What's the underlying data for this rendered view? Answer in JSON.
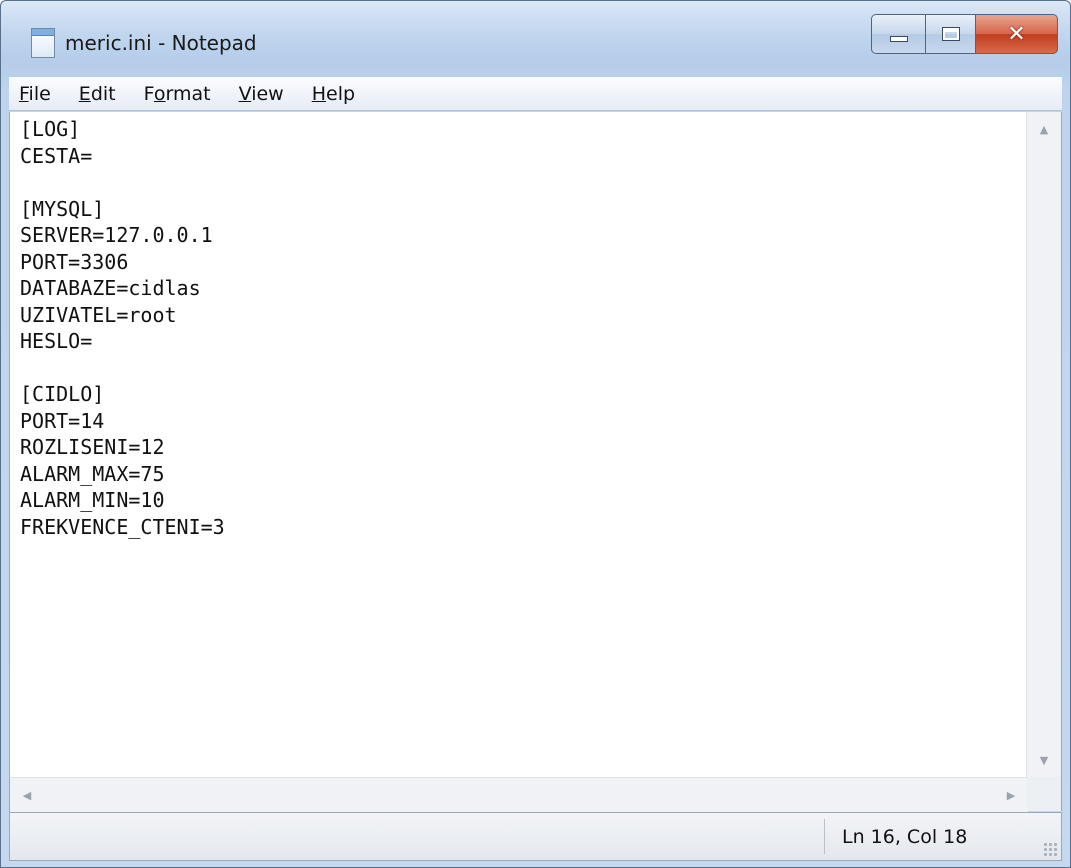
{
  "window": {
    "title": "meric.ini - Notepad"
  },
  "menu": [
    {
      "mnemonic": "F",
      "rest": "ile"
    },
    {
      "mnemonic": "E",
      "rest": "dit"
    },
    {
      "pre": "F",
      "mnemonic": "o",
      "rest": "rmat"
    },
    {
      "mnemonic": "V",
      "rest": "iew"
    },
    {
      "mnemonic": "H",
      "rest": "elp"
    }
  ],
  "editor": {
    "text": "[LOG]\nCESTA=\n\n[MYSQL]\nSERVER=127.0.0.1\nPORT=3306\nDATABAZE=cidlas\nUZIVATEL=root\nHESLO=\n\n[CIDLO]\nPORT=14\nROZLISENI=12\nALARM_MAX=75\nALARM_MIN=10\nFREKVENCE_CTENI=3"
  },
  "status": {
    "position": "Ln 16, Col 18"
  },
  "icons": {
    "app": "notepad-icon",
    "minimize": "minimize-icon",
    "maximize": "maximize-icon",
    "close": "close-icon"
  }
}
